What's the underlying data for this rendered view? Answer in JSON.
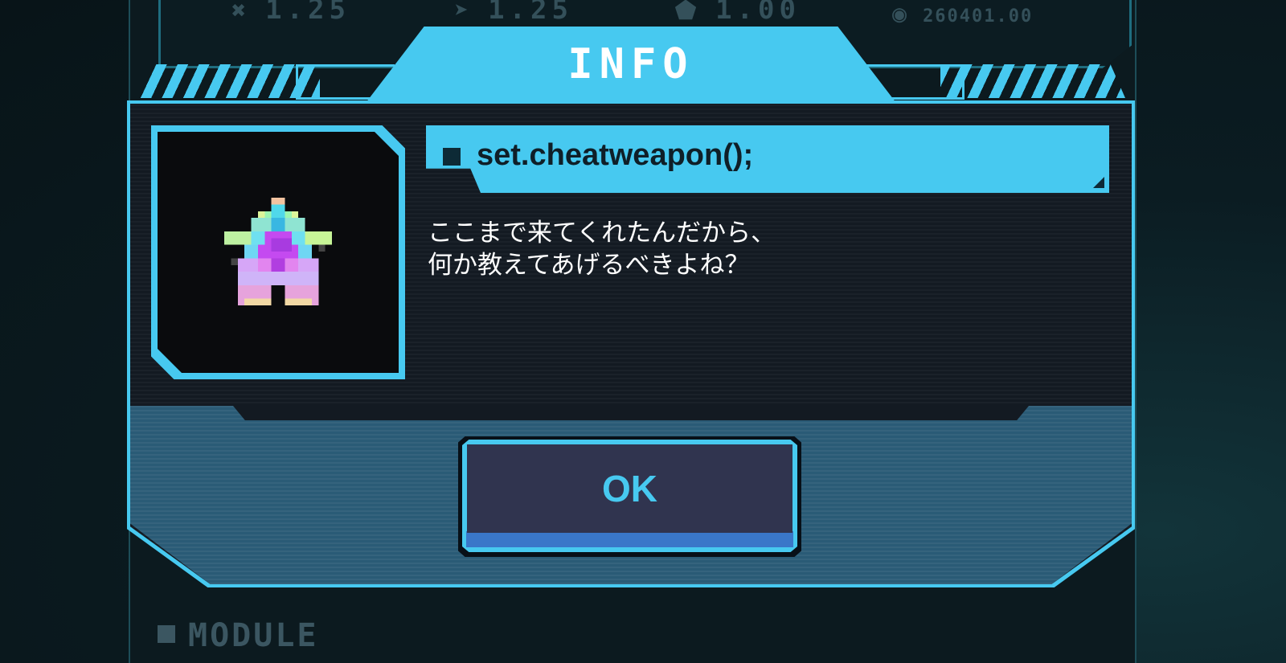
{
  "stats": [
    {
      "icon": "crossed-swords-icon",
      "glyph": "✖",
      "value": "1.25"
    },
    {
      "icon": "bullet-icon",
      "glyph": "➤",
      "value": "1.25"
    },
    {
      "icon": "shield-icon",
      "glyph": "⬟",
      "value": "1.00"
    },
    {
      "icon": "coin-icon",
      "glyph": "◉",
      "value": "260401.00"
    }
  ],
  "dialog": {
    "title": "INFO",
    "item_name": "set.cheatweapon();",
    "message_line1": "ここまで来てくれたんだから、",
    "message_line2": "何か教えてあげるべきよね？",
    "ok_label": "OK"
  },
  "footer": {
    "section_label": "MODULE"
  },
  "colors": {
    "accent": "#47c9f0",
    "panel_dark": "#131a22",
    "button_face": "#30344f"
  }
}
